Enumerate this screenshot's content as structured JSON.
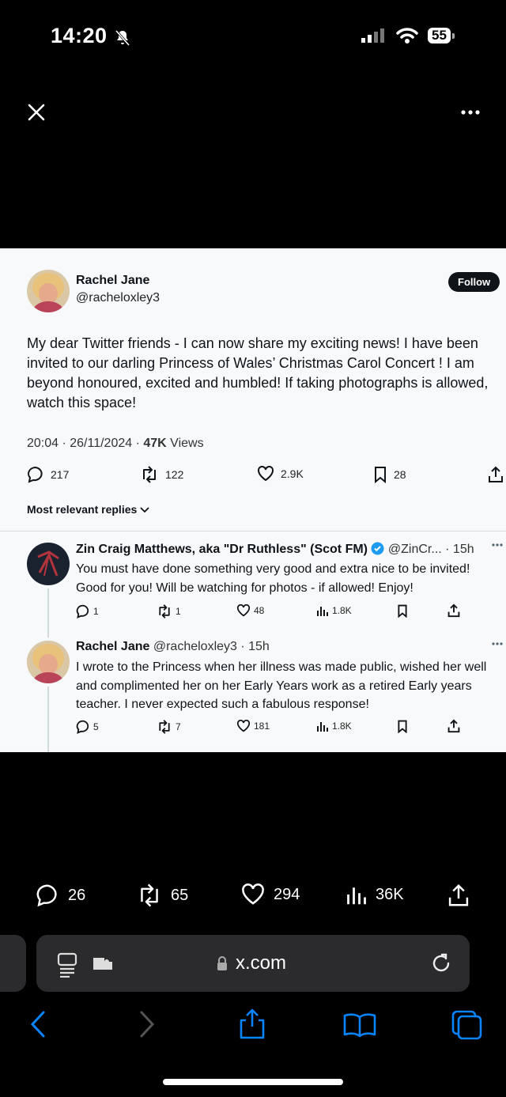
{
  "status_bar": {
    "time": "14:20",
    "battery": "55"
  },
  "top_bar": {
    "close_icon": "close-icon",
    "more_icon": "more-icon"
  },
  "tweet": {
    "author_name": "Rachel Jane",
    "handle": "@racheloxley3",
    "follow_label": "Follow",
    "text": "My dear Twitter friends - I can now share my exciting news! I have been invited to our darling Princess of Wales’ Christmas Carol Concert ! I am beyond honoured, excited and humbled! If taking photographs is allowed, watch this space!",
    "timestamp": "20:04 · 26/11/2024 · ",
    "views_count": "47K",
    "views_label": " Views",
    "replies": "217",
    "reposts": "122",
    "likes": "2.9K",
    "bookmarks": "28"
  },
  "replies_header": "Most relevant replies",
  "replies": [
    {
      "name": "Zin Craig Matthews, aka \"Dr Ruthless\" (Scot FM)",
      "handle": "@ZinCr... · 15h",
      "text": "You must have done something very good and extra nice to be invited! Good for you! Will be watching for photos - if allowed! Enjoy!",
      "replies": "1",
      "reposts": "1",
      "likes": "48",
      "views": "1.8K"
    },
    {
      "name": "Rachel Jane",
      "handle": "@racheloxley3 · 15h",
      "text": "I wrote to the Princess when her illness was made public, wished her well and complimented her on her Early Years work as a retired Early years teacher. I never expected such a fabulous response!",
      "replies": "5",
      "reposts": "7",
      "likes": "181",
      "views": "1.8K"
    }
  ],
  "bottom_actions": {
    "replies": "26",
    "reposts": "65",
    "likes": "294",
    "views": "36K"
  },
  "browser": {
    "url": "x.com"
  },
  "colors": {
    "verified": "#1d9bf0",
    "safari_blue": "#0a84ff"
  }
}
